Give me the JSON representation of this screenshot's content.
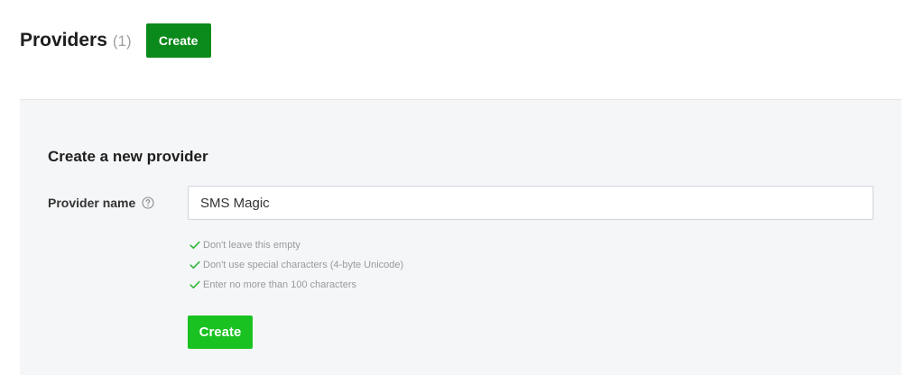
{
  "header": {
    "title": "Providers",
    "count": "(1)",
    "create_label": "Create"
  },
  "form": {
    "heading": "Create a new provider",
    "field_label": "Provider name",
    "field_value": "SMS Magic",
    "help_icon": "question-circle-icon",
    "rules": [
      "Don't leave this empty",
      "Don't use special characters (4-byte Unicode)",
      "Enter no more than 100 characters"
    ],
    "rule_icon": "check-icon",
    "submit_label": "Create"
  },
  "colors": {
    "header_button": "#0a8a1a",
    "submit_button": "#19c221",
    "check": "#2fb83a",
    "panel_background": "#f5f6f8"
  }
}
